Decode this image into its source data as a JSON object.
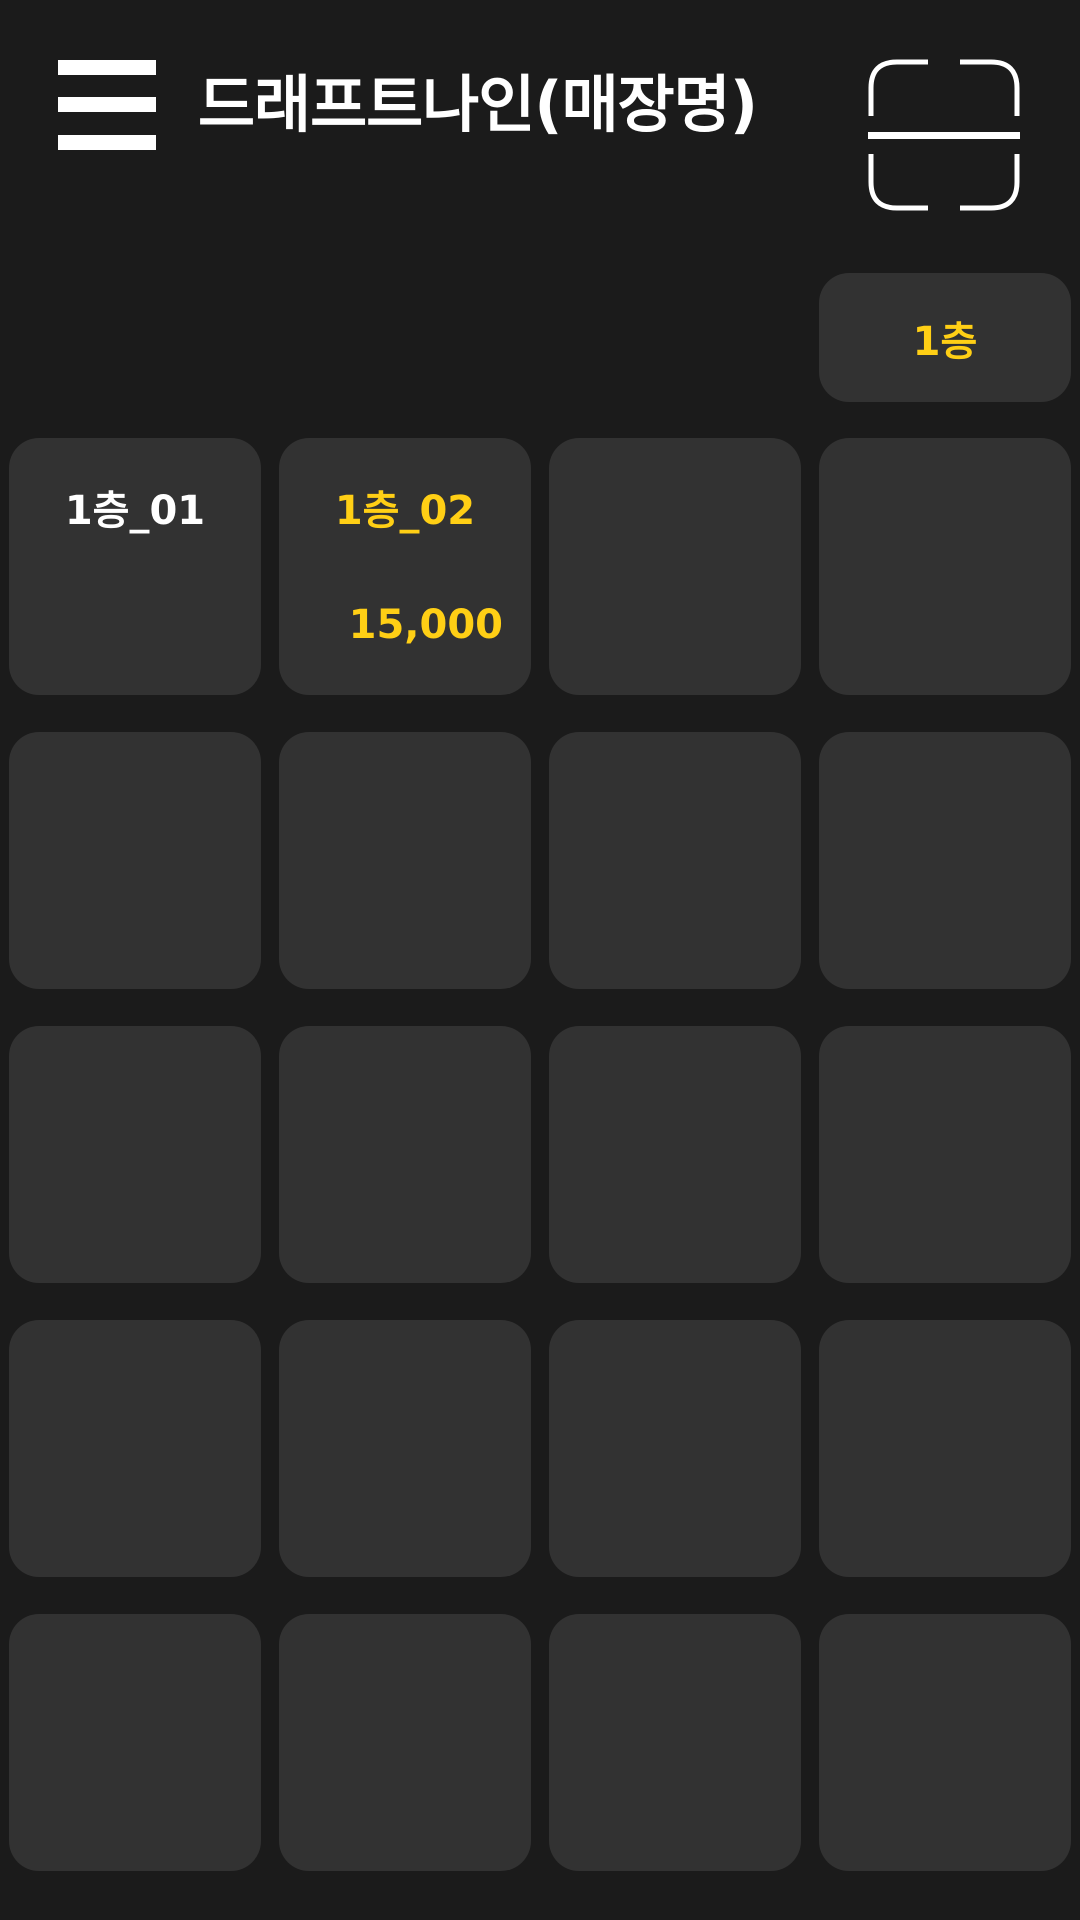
{
  "header": {
    "title": "드래프트나인(매장명)",
    "menu_icon": "hamburger-menu-icon",
    "scan_icon": "qr-scan-icon"
  },
  "floors": {
    "selected": "1층"
  },
  "colors": {
    "background": "#1b1b1b",
    "tile": "#323232",
    "accent": "#ffcf15",
    "text": "#ffffff"
  },
  "tables": [
    {
      "name": "1층_01",
      "amount": "",
      "occupied": false
    },
    {
      "name": "1층_02",
      "amount": "15,000",
      "occupied": true
    },
    {
      "name": "",
      "amount": "",
      "occupied": false
    },
    {
      "name": "",
      "amount": "",
      "occupied": false
    },
    {
      "name": "",
      "amount": "",
      "occupied": false
    },
    {
      "name": "",
      "amount": "",
      "occupied": false
    },
    {
      "name": "",
      "amount": "",
      "occupied": false
    },
    {
      "name": "",
      "amount": "",
      "occupied": false
    },
    {
      "name": "",
      "amount": "",
      "occupied": false
    },
    {
      "name": "",
      "amount": "",
      "occupied": false
    },
    {
      "name": "",
      "amount": "",
      "occupied": false
    },
    {
      "name": "",
      "amount": "",
      "occupied": false
    },
    {
      "name": "",
      "amount": "",
      "occupied": false
    },
    {
      "name": "",
      "amount": "",
      "occupied": false
    },
    {
      "name": "",
      "amount": "",
      "occupied": false
    },
    {
      "name": "",
      "amount": "",
      "occupied": false
    },
    {
      "name": "",
      "amount": "",
      "occupied": false
    },
    {
      "name": "",
      "amount": "",
      "occupied": false
    },
    {
      "name": "",
      "amount": "",
      "occupied": false
    },
    {
      "name": "",
      "amount": "",
      "occupied": false
    }
  ]
}
